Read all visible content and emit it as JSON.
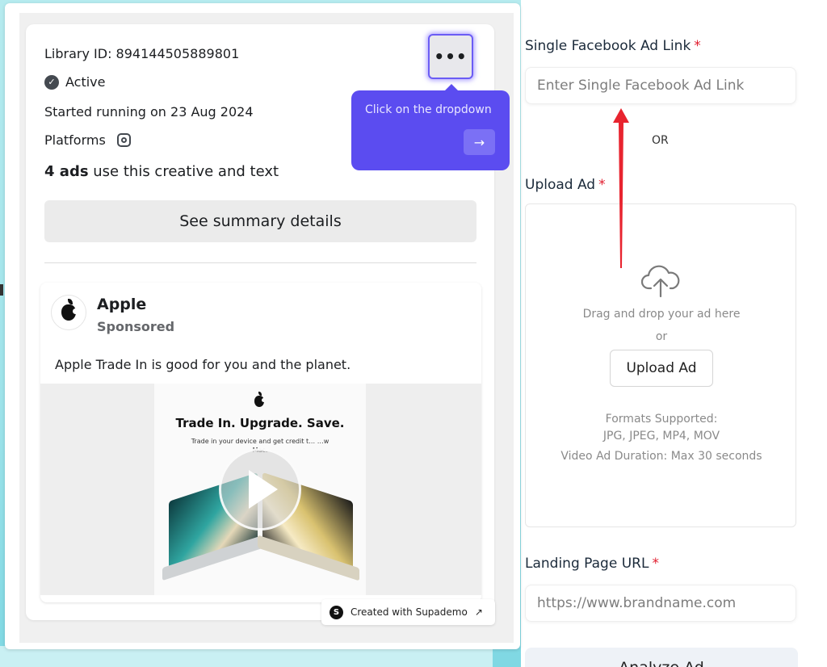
{
  "demo": {
    "library_id": "Library ID: 894144505889801",
    "status": "Active",
    "started": "Started running on 23 Aug 2024",
    "platforms_label": "Platforms",
    "ads_count": "4 ads",
    "ads_text": " use this creative and text",
    "summary_button": "See summary details",
    "more_button": "•••",
    "tooltip": {
      "text": "Click on the dropdown",
      "next": "→"
    },
    "post": {
      "advertiser": "Apple",
      "sponsored": "Sponsored",
      "body": "Apple Trade In is good for you and the planet.",
      "media_headline": "Trade In. Upgrade. Save.",
      "media_sub": "Trade in your device and get credit t… …w Mac."
    },
    "badge": {
      "logo": "S",
      "text": "Created with Supademo",
      "arrow": "↗"
    }
  },
  "form": {
    "fb_link": {
      "label": "Single Facebook Ad Link",
      "required": "*",
      "placeholder": "Enter Single Facebook Ad Link"
    },
    "or": "OR",
    "upload": {
      "label": "Upload Ad",
      "required": "*",
      "drag_text": "Drag and drop your ad here",
      "or": "or",
      "button": "Upload Ad",
      "formats_title": "Formats Supported:",
      "formats": "JPG, JPEG, MP4, MOV",
      "duration": "Video Ad Duration: Max 30 seconds"
    },
    "landing": {
      "label": "Landing Page URL",
      "required": "*",
      "placeholder": "https://www.brandname.com"
    },
    "analyze_button": "Analyze Ad"
  },
  "colors": {
    "accent": "#5b4cf0",
    "required": "#e11d2e",
    "arrow": "#e8242f"
  }
}
